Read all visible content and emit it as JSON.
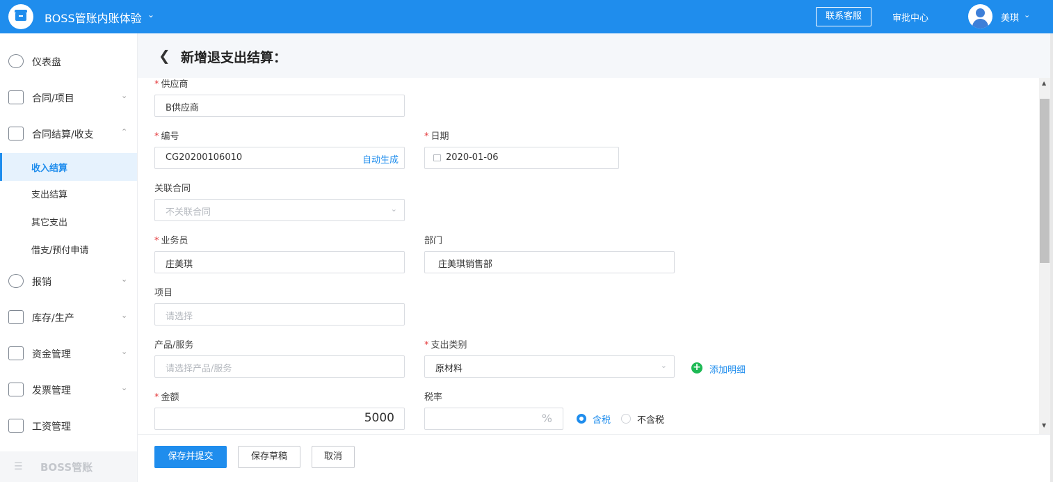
{
  "topbar": {
    "app_title": "BOSS管账内账体验",
    "contact_label": "联系客服",
    "approval_label": "审批中心",
    "user_name": "美琪"
  },
  "sidebar": {
    "items": [
      {
        "label": "仪表盘",
        "icon": "dashboard-icon"
      },
      {
        "label": "合同/项目",
        "icon": "folder-icon"
      },
      {
        "label": "合同结算/收支",
        "icon": "settlement-icon"
      },
      {
        "label": "报销",
        "icon": "reimburse-icon"
      },
      {
        "label": "库存/生产",
        "icon": "box-icon"
      },
      {
        "label": "资金管理",
        "icon": "fund-icon"
      },
      {
        "label": "发票管理",
        "icon": "invoice-icon"
      },
      {
        "label": "工资管理",
        "icon": "salary-icon"
      }
    ],
    "sub_items": [
      "收入结算",
      "支出结算",
      "其它支出",
      "借支/预付申请"
    ],
    "active_sub": "收入结算",
    "footer_label": "BOSS管账"
  },
  "page": {
    "title": "新增退支出结算："
  },
  "form": {
    "supplier": {
      "label": "供应商",
      "value": "B供应商"
    },
    "number": {
      "label": "编号",
      "value": "CG20200106010",
      "suffix": "自动生成"
    },
    "date": {
      "label": "日期",
      "value": "2020-01-06"
    },
    "contract": {
      "label": "关联合同",
      "placeholder": "不关联合同"
    },
    "salesman": {
      "label": "业务员",
      "value": "庄美琪"
    },
    "department": {
      "label": "部门",
      "value": "庄美琪销售部"
    },
    "project": {
      "label": "项目",
      "placeholder": "请选择"
    },
    "product": {
      "label": "产品/服务",
      "placeholder": "请选择产品/服务"
    },
    "expense_type": {
      "label": "支出类别",
      "value": "原材料"
    },
    "add_detail": "添加明细",
    "amount": {
      "label": "金额",
      "value": "5000"
    },
    "tax_rate": {
      "label": "税率",
      "unit": "%"
    },
    "tax_options": [
      "含税",
      "不含税"
    ],
    "tax_selected": "含税"
  },
  "footer": {
    "submit": "保存并提交",
    "draft": "保存草稿",
    "cancel": "取消"
  },
  "colors": {
    "primary": "#1f8ded",
    "required": "#e4393c",
    "add": "#1db954"
  }
}
